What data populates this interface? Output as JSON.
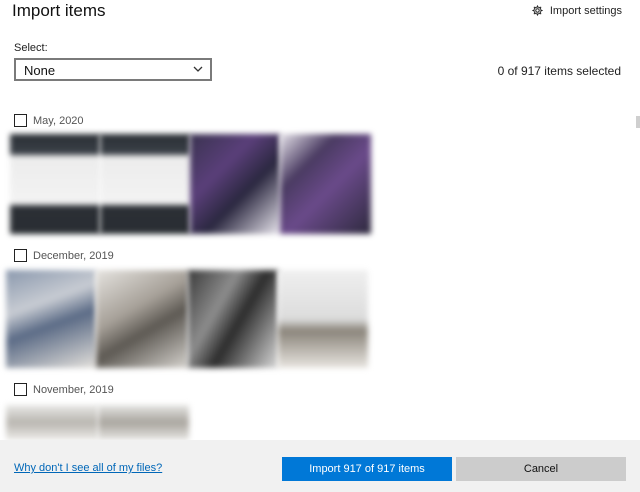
{
  "window": {
    "title": "Import items",
    "settings_label": "Import settings",
    "settings_icon": "gear-icon"
  },
  "select": {
    "label": "Select:",
    "value": "None",
    "icon": "chevron-down-icon"
  },
  "selection_count": "0 of 917 items selected",
  "groups": [
    {
      "date": "May, 2020",
      "checked": false
    },
    {
      "date": "December, 2019",
      "checked": false
    },
    {
      "date": "November, 2019",
      "checked": false
    }
  ],
  "footer": {
    "help_link": "Why don't I see all of my files?",
    "import_button": "Import 917 of 917 items",
    "cancel_button": "Cancel"
  },
  "colors": {
    "accent": "#0078d7",
    "link": "#0067b8",
    "footer_bg": "#f1f1f1"
  }
}
